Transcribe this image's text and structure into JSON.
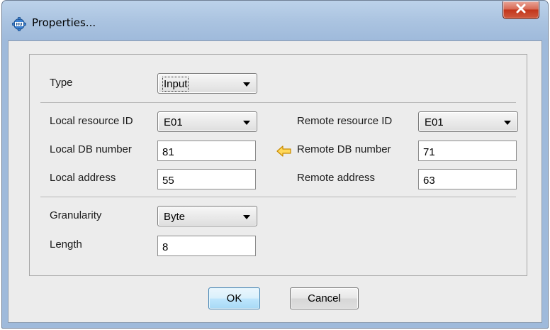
{
  "window": {
    "title": "Properties...",
    "app_icon": "gear-app-icon",
    "close_icon": "close-icon"
  },
  "form": {
    "type": {
      "label": "Type",
      "value": "Input"
    },
    "local_resource_id": {
      "label": "Local resource ID",
      "value": "E01"
    },
    "remote_resource_id": {
      "label": "Remote resource ID",
      "value": "E01"
    },
    "local_db_number": {
      "label": "Local DB number",
      "value": "81"
    },
    "remote_db_number": {
      "label": "Remote DB number",
      "value": "71"
    },
    "transfer_arrow_icon": "arrow-left-icon",
    "local_address": {
      "label": "Local address",
      "value": "55"
    },
    "remote_address": {
      "label": "Remote address",
      "value": "63"
    },
    "granularity": {
      "label": "Granularity",
      "value": "Byte"
    },
    "length": {
      "label": "Length",
      "value": "8"
    }
  },
  "buttons": {
    "ok": "OK",
    "cancel": "Cancel"
  },
  "colors": {
    "arrow_fill": "#ffd85a",
    "arrow_stroke": "#c88a00",
    "close_red": "#c2351b"
  }
}
